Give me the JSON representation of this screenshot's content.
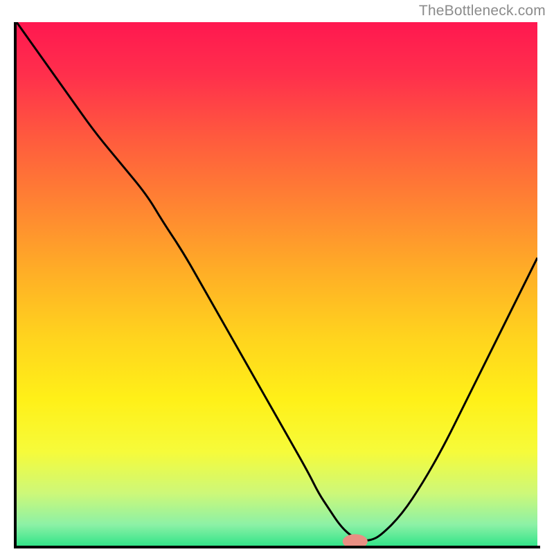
{
  "watermark": "TheBottleneck.com",
  "colors": {
    "gradient_stops": [
      {
        "offset": 0.0,
        "color": "#ff1850"
      },
      {
        "offset": 0.1,
        "color": "#ff2f4c"
      },
      {
        "offset": 0.22,
        "color": "#ff5a3e"
      },
      {
        "offset": 0.35,
        "color": "#ff8432"
      },
      {
        "offset": 0.48,
        "color": "#ffaf26"
      },
      {
        "offset": 0.6,
        "color": "#ffd31e"
      },
      {
        "offset": 0.72,
        "color": "#fff018"
      },
      {
        "offset": 0.82,
        "color": "#f6fb3a"
      },
      {
        "offset": 0.9,
        "color": "#cdf879"
      },
      {
        "offset": 0.96,
        "color": "#8cf1a6"
      },
      {
        "offset": 1.0,
        "color": "#33e489"
      }
    ],
    "marker": "#e98f83",
    "axis": "#000000"
  },
  "chart_data": {
    "type": "line",
    "title": "",
    "xlabel": "",
    "ylabel": "",
    "xlim": [
      0,
      100
    ],
    "ylim": [
      0,
      100
    ],
    "grid": false,
    "series": [
      {
        "name": "bottleneck-curve",
        "x": [
          0,
          5,
          10,
          15,
          20,
          25,
          28,
          32,
          36,
          40,
          44,
          48,
          52,
          56,
          58,
          60,
          62,
          64,
          66,
          68,
          70,
          74,
          78,
          82,
          86,
          90,
          94,
          98,
          100
        ],
        "values": [
          100,
          93,
          86,
          79,
          73,
          67,
          62,
          56,
          49,
          42,
          35,
          28,
          21,
          14,
          10,
          7,
          4,
          2,
          1,
          1,
          2,
          6,
          12,
          19,
          27,
          35,
          43,
          51,
          55
        ]
      }
    ],
    "marker": {
      "x": 65,
      "y": 0.8,
      "rx": 2.4,
      "ry": 1.4
    },
    "flat_segment": {
      "x_start": 60,
      "x_end": 67,
      "y": 0.8
    }
  }
}
